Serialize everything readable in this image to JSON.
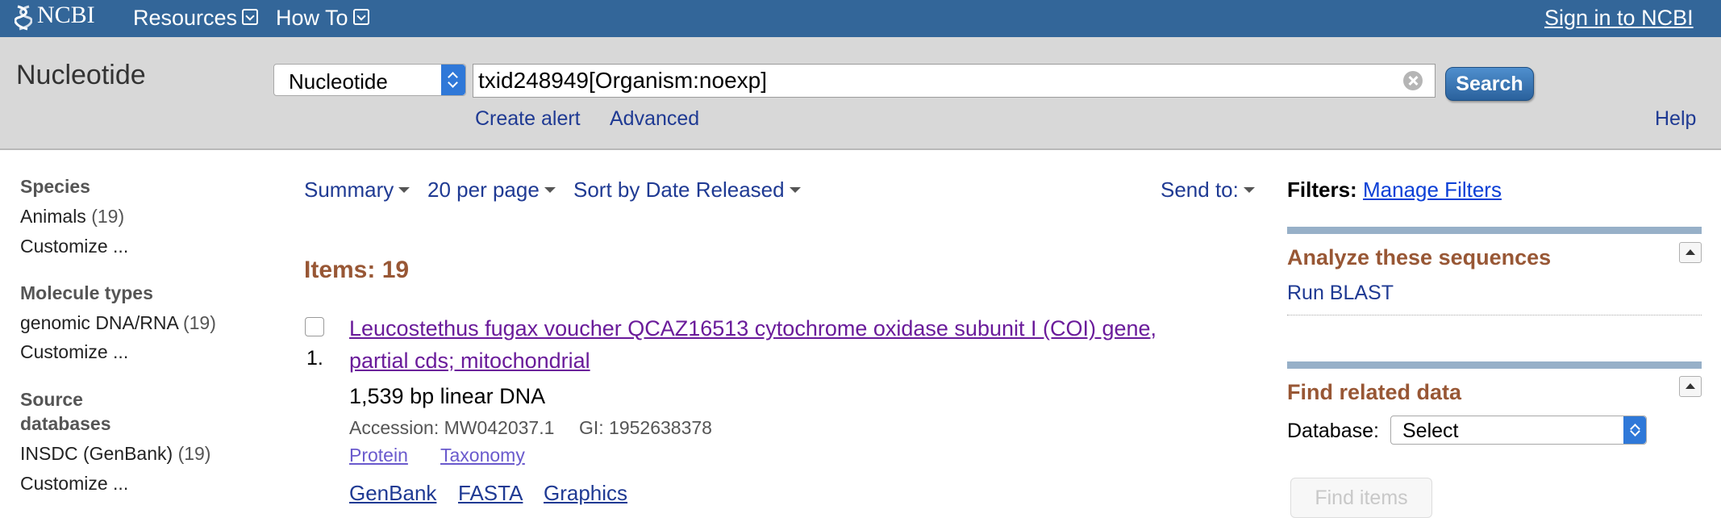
{
  "topbar": {
    "logo_text": "NCBI",
    "resources_label": "Resources",
    "howto_label": "How To",
    "signin_label": "Sign in to NCBI"
  },
  "search": {
    "db_title": "Nucleotide",
    "db_select_value": "Nucleotide",
    "query_value": "txid248949[Organism:noexp]",
    "button_label": "Search",
    "create_alert_label": "Create alert",
    "advanced_label": "Advanced",
    "help_label": "Help"
  },
  "facets": {
    "species_head": "Species",
    "species_item": "Animals",
    "species_count": "(19)",
    "species_customize": "Customize ...",
    "moltype_head": "Molecule types",
    "moltype_item": "genomic DNA/RNA",
    "moltype_count": "(19)",
    "moltype_customize": "Customize ...",
    "source_head_line1": "Source",
    "source_head_line2": "databases",
    "source_item": "INSDC (GenBank)",
    "source_count": "(19)",
    "source_customize": "Customize ..."
  },
  "toolbar": {
    "summary": "Summary",
    "per_page": "20 per page",
    "sort": "Sort by Date Released",
    "send_to": "Send to:"
  },
  "results": {
    "items_label": "Items: 19",
    "list": [
      {
        "number": "1.",
        "title_line1": "Leucostethus fugax voucher QCAZ16513 cytochrome oxidase subunit I (COI) gene,",
        "title_line2": "partial cds; mitochondrial",
        "length": "1,539 bp linear DNA",
        "accession": "Accession: MW042037.1",
        "gi": "GI: 1952638378",
        "link_protein": "Protein",
        "link_taxonomy": "Taxonomy",
        "fmt_genbank": "GenBank",
        "fmt_fasta": "FASTA",
        "fmt_graphics": "Graphics"
      }
    ]
  },
  "right": {
    "filters_label": "Filters:",
    "manage_filters": "Manage Filters",
    "analyze_head": "Analyze these sequences",
    "run_blast": "Run BLAST",
    "related_head": "Find related data",
    "database_label": "Database:",
    "database_select_value": "Select",
    "find_items_label": "Find items"
  },
  "colors": {
    "topbar": "#336699",
    "search_band": "#d8d8d8",
    "heading_brown": "#985735",
    "link_blue": "#1f3a93",
    "visited_purple": "#6a1b9a"
  }
}
